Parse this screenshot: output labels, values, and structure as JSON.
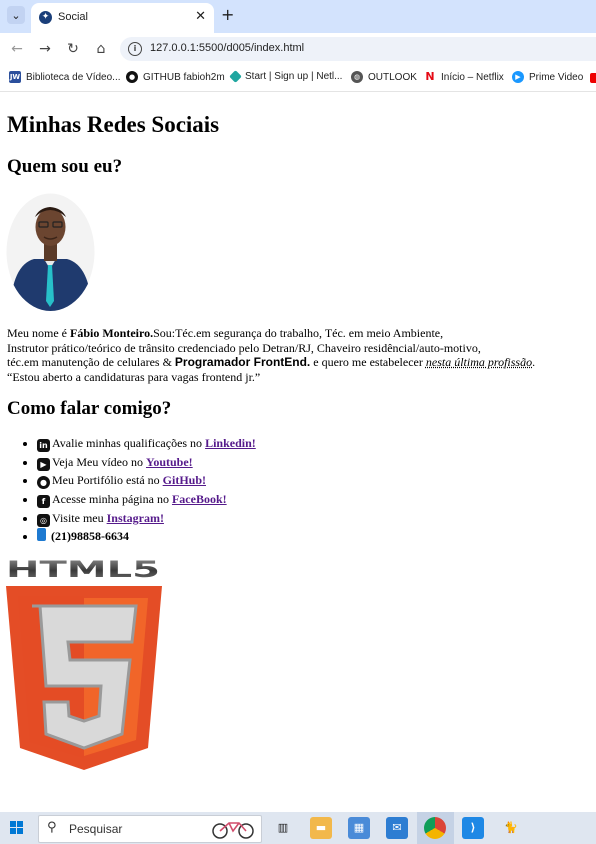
{
  "browser": {
    "tab_title": "Social",
    "url": "127.0.0.1:5500/d005/index.html",
    "bookmarks": [
      {
        "label": "Biblioteca de Vídeo...",
        "icon": "jw-icon",
        "color": "#2b4f9c"
      },
      {
        "label": "GITHUB fabioh2m",
        "icon": "github-icon",
        "color": "#111111"
      },
      {
        "label": "Start | Sign up | Netl...",
        "icon": "netlify-icon",
        "color": "#20a6a0"
      },
      {
        "label": "OUTLOOK",
        "icon": "globe-icon",
        "color": "#555555"
      },
      {
        "label": "Início – Netflix",
        "icon": "netflix-icon",
        "color": "#e50914"
      },
      {
        "label": "Prime Video",
        "icon": "prime-video-icon",
        "color": "#1a98ff"
      }
    ]
  },
  "page": {
    "title": "Minhas Redes Sociais",
    "about_heading": "Quem sou eu?",
    "bio": {
      "l1_pre": "Meu nome é ",
      "l1_name": "Fábio Monteiro.",
      "l1_post": "Sou:Téc.em segurança do trabalho, Téc. em meio Ambiente,",
      "l2": "Instrutor prático/teórico de trânsito credenciado pelo Detran/RJ, Chaveiro residêncial/auto-motivo,",
      "l3_pre": "téc.em manutenção de celulares & ",
      "l3_role": "Programador FrontEnd.",
      "l3_mid": " e quero me estabelecer ",
      "l3_em": "nesta última profissão",
      "l3_end": ".",
      "l4": "“Estou aberto a candidaturas para vagas frontend jr.”"
    },
    "contact_heading": "Como falar comigo?",
    "links": [
      {
        "icon": "linkedin-icon",
        "glyph": "in",
        "text": "Avalie minhas qualificações no ",
        "link": "Linkedin!"
      },
      {
        "icon": "youtube-icon",
        "glyph": "▶",
        "text": "Veja Meu vídeo no ",
        "link": "Youtube!"
      },
      {
        "icon": "github-icon",
        "glyph": "●",
        "text": "Meu Portifólio está no ",
        "link": "GitHub!"
      },
      {
        "icon": "facebook-icon",
        "glyph": "f",
        "text": "Acesse minha página no ",
        "link": "FaceBook!"
      },
      {
        "icon": "instagram-icon",
        "glyph": "◎",
        "text": "Visite meu ",
        "link": "Instagram!"
      }
    ],
    "phone": "(21)98858-6634",
    "html5_word": "HTML5",
    "html5_number": "5"
  },
  "taskbar": {
    "search_placeholder": "Pesquisar"
  }
}
